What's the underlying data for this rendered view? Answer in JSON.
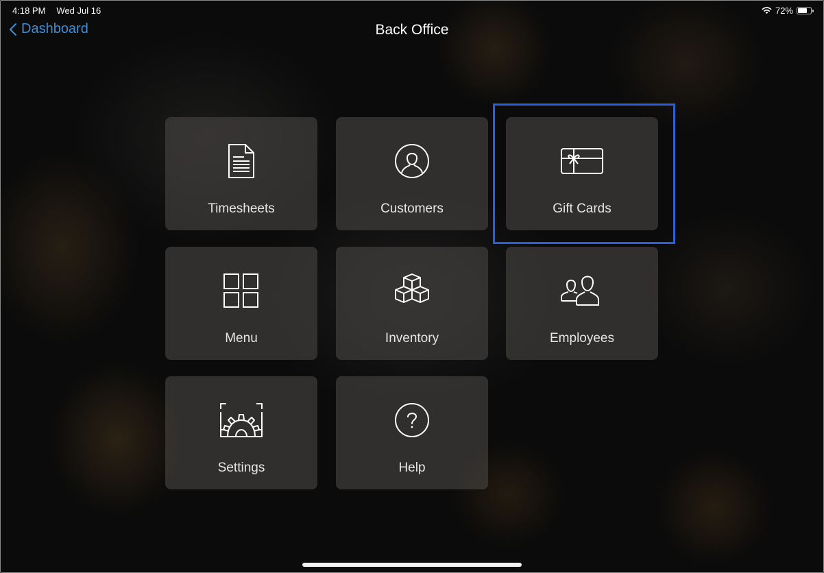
{
  "status_bar": {
    "time": "4:18 PM",
    "date": "Wed Jul 16",
    "battery_percent": "72%",
    "battery_level": 0.72
  },
  "nav": {
    "back_label": "Dashboard",
    "title": "Back Office"
  },
  "tiles": [
    {
      "label": "Timesheets",
      "icon": "document-icon"
    },
    {
      "label": "Customers",
      "icon": "user-circle-icon"
    },
    {
      "label": "Gift Cards",
      "icon": "gift-card-icon"
    },
    {
      "label": "Menu",
      "icon": "grid-icon"
    },
    {
      "label": "Inventory",
      "icon": "boxes-icon"
    },
    {
      "label": "Employees",
      "icon": "users-icon"
    },
    {
      "label": "Settings",
      "icon": "settings-gear-icon"
    },
    {
      "label": "Help",
      "icon": "help-icon"
    }
  ],
  "colors": {
    "accent": "#3a8fd9",
    "highlight": "#2b5ed8",
    "tile_label": "#e6e6e6"
  }
}
